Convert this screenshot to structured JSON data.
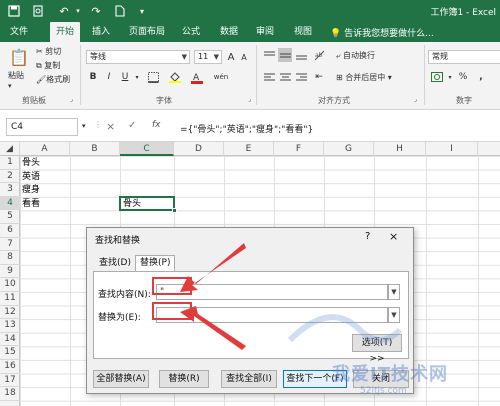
{
  "window": {
    "title": "工作簿1 - Excel"
  },
  "tabs": [
    "文件",
    "开始",
    "插入",
    "页面布局",
    "公式",
    "数据",
    "审阅",
    "视图"
  ],
  "active_tab": "开始",
  "tell_me": "告诉我您想要做什么...",
  "ribbon": {
    "clipboard": {
      "paste": "粘贴",
      "cut": "剪切",
      "copy": "复制",
      "format_painter": "格式刷",
      "label": "剪贴板"
    },
    "font": {
      "font_name": "等线",
      "font_size": "11",
      "label": "字体",
      "grow": "A",
      "shrink": "A",
      "bold": "B",
      "italic": "I",
      "underline": "U",
      "font_color_char": "A",
      "wen": "wén"
    },
    "alignment": {
      "wrap_text": "自动换行",
      "merge_center": "合并后居中",
      "label": "对齐方式"
    },
    "number": {
      "format": "常规",
      "label": "数字",
      "percent": "%",
      "comma": ","
    }
  },
  "formula_bar": {
    "name_box": "C4",
    "cancel": "×",
    "enter": "✓",
    "fx": "fx",
    "formula": "={\"骨头\";\"英语\";\"瘦身\";\"看看\"}"
  },
  "columns": [
    "A",
    "B",
    "C",
    "D",
    "E",
    "F",
    "G",
    "H",
    "I"
  ],
  "selected_column": "C",
  "rows": [
    "1",
    "2",
    "3",
    "4",
    "5",
    "6",
    "7",
    "8",
    "9",
    "10",
    "11",
    "12",
    "13",
    "14",
    "15",
    "16",
    "17",
    "18"
  ],
  "selected_row": "4",
  "cells": {
    "A1": "骨头",
    "A2": "英语",
    "A3": "瘦身",
    "A4": "看看",
    "C4": "骨头"
  },
  "dialog": {
    "title": "查找和替换",
    "help": "?",
    "close": "×",
    "tab_find": "查找(D)",
    "tab_replace": "替换(P)",
    "find_label": "查找内容(N):",
    "find_value": "\"",
    "replace_label": "替换为(E):",
    "replace_value": "",
    "options": "选项(T) >>",
    "replace_all": "全部替换(A)",
    "replace": "替换(R)",
    "find_all": "查找全部(I)",
    "find_next": "查找下一个(F)",
    "close_btn": "关闭"
  },
  "watermark": {
    "text": "我爱IT技术网",
    "url": "52itjs.com"
  },
  "colors": {
    "excel_green": "#217346",
    "annotation_red": "#e23b3b"
  }
}
